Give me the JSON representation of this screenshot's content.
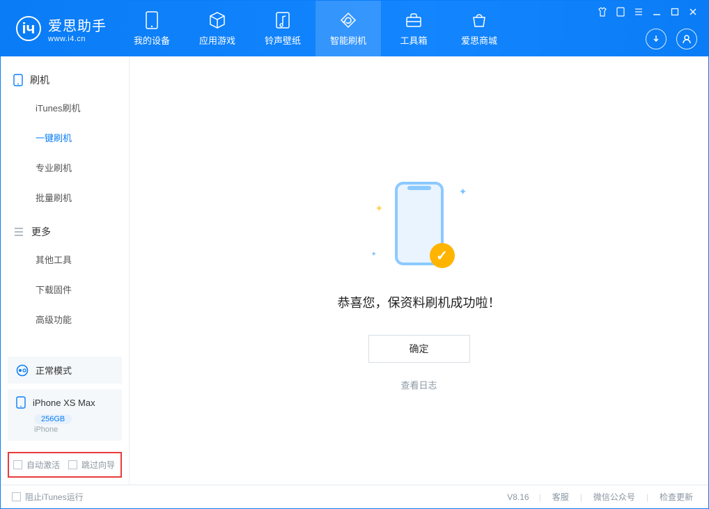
{
  "app": {
    "name": "爱思助手",
    "domain": "www.i4.cn"
  },
  "colors": {
    "primary": "#0a7cf5",
    "accent": "#ffb400",
    "danger_border": "#e83a3a"
  },
  "header": {
    "tabs": [
      {
        "icon": "phone-icon",
        "label": "我的设备"
      },
      {
        "icon": "cube-icon",
        "label": "应用游戏"
      },
      {
        "icon": "music-icon",
        "label": "铃声壁纸"
      },
      {
        "icon": "refresh-icon",
        "label": "智能刷机",
        "active": true
      },
      {
        "icon": "toolbox-icon",
        "label": "工具箱"
      },
      {
        "icon": "store-icon",
        "label": "爱思商城"
      }
    ],
    "window_controls": [
      "shirt-icon",
      "phone-small-icon",
      "menu-icon",
      "minimize-icon",
      "maximize-icon",
      "close-icon"
    ]
  },
  "sidebar": {
    "sections": [
      {
        "icon": "phone-outline-icon",
        "title": "刷机",
        "items": [
          "iTunes刷机",
          "一键刷机",
          "专业刷机",
          "批量刷机"
        ],
        "active_index": 1
      },
      {
        "icon": "list-icon",
        "title": "更多",
        "items": [
          "其他工具",
          "下载固件",
          "高级功能"
        ]
      }
    ],
    "mode": {
      "label": "正常模式"
    },
    "device": {
      "name": "iPhone XS Max",
      "storage": "256GB",
      "type": "iPhone"
    },
    "checkboxes": {
      "auto_activate": "自动激活",
      "skip_guide": "跳过向导"
    }
  },
  "main": {
    "success_text": "恭喜您，保资料刷机成功啦！",
    "confirm_label": "确定",
    "log_link": "查看日志"
  },
  "footer": {
    "stop_itunes": "阻止iTunes运行",
    "version": "V8.16",
    "links": [
      "客服",
      "微信公众号",
      "检查更新"
    ]
  }
}
